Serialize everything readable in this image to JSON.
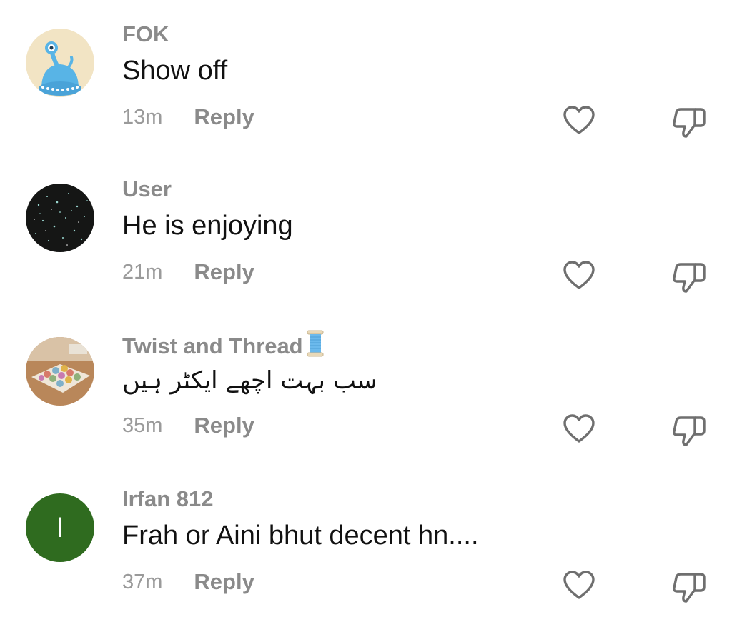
{
  "comments": [
    {
      "username": "FOK",
      "text": "Show off",
      "time": "13m",
      "reply_label": "Reply",
      "avatar": "alien-icon"
    },
    {
      "username": "User",
      "text": "He is enjoying",
      "time": "21m",
      "reply_label": "Reply",
      "avatar": "starry-night-photo"
    },
    {
      "username": "Twist and Thread",
      "username_emoji": "spool-of-thread-icon",
      "text": "سب بہت اچھے ایکٹر ہیں",
      "time": "35m",
      "reply_label": "Reply",
      "avatar": "crochet-blanket-photo"
    },
    {
      "username": "Irfan 812",
      "text": "Frah or Aini bhut decent hn....",
      "time": "37m",
      "reply_label": "Reply",
      "avatar_letter": "I",
      "avatar_color": "#2f6b1f"
    }
  ],
  "colors": {
    "username": "#8a8a8a",
    "body_text": "#111111",
    "meta": "#9a9a9a",
    "icon_stroke": "#6f6f6f"
  }
}
